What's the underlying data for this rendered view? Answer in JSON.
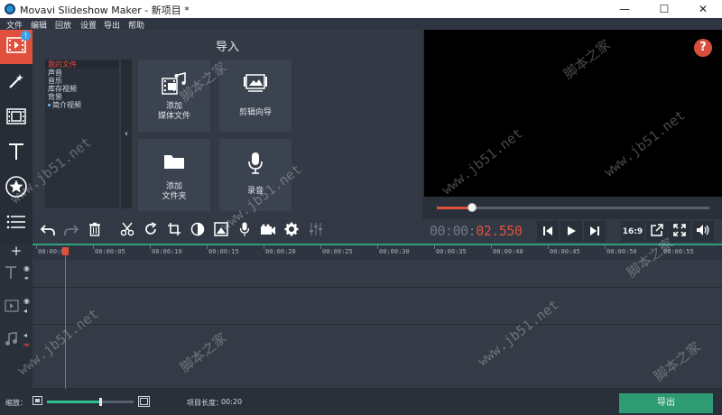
{
  "window": {
    "title": "Movavi Slideshow Maker - 新项目 *",
    "controls": {
      "minimize": "—",
      "maximize": "☐",
      "close": "✕"
    }
  },
  "menu": [
    "文件",
    "编辑",
    "回放",
    "设置",
    "导出",
    "帮助"
  ],
  "sidebar": {
    "badge": "!",
    "tools": [
      {
        "name": "import-tool",
        "icon": "film-import-icon",
        "active": true
      },
      {
        "name": "filters-tool",
        "icon": "magic-wand-icon"
      },
      {
        "name": "transitions-tool",
        "icon": "transition-icon"
      },
      {
        "name": "titles-tool",
        "icon": "text-t-icon"
      },
      {
        "name": "stickers-tool",
        "icon": "star-icon"
      },
      {
        "name": "more-tool",
        "icon": "list-icon"
      }
    ]
  },
  "import_panel": {
    "title": "导入",
    "tree": [
      {
        "label": "我的文件",
        "selected": true
      },
      {
        "label": "声音"
      },
      {
        "label": "音乐"
      },
      {
        "label": "库存视频"
      },
      {
        "label": "背景"
      },
      {
        "label": "简介视频",
        "bullet": true
      }
    ],
    "collapse_icon": "‹",
    "tiles": {
      "add_media": {
        "line1": "添加",
        "line2": "媒体文件",
        "icon": "media-file-icon"
      },
      "montage": {
        "line1": "剪辑向导",
        "icon": "montage-wizard-icon"
      },
      "add_folder": {
        "line1": "添加",
        "line2": "文件夹",
        "icon": "folder-icon"
      },
      "record": {
        "line1": "录音",
        "icon": "microphone-icon"
      }
    }
  },
  "preview": {
    "help_label": "?",
    "scrub_progress": 0.128
  },
  "playback": {
    "timecode_prefix": "00:00:",
    "timecode_value": "02.550",
    "aspect": "16:9"
  },
  "timeline": {
    "add_label": "+",
    "ticks": [
      "00:00:00",
      "00:00:05",
      "00:00:10",
      "00:00:15",
      "00:00:20",
      "00:00:25",
      "00:00:30",
      "00:00:35",
      "00:00:40",
      "00:00:45",
      "00:00:50",
      "00:00:55"
    ]
  },
  "statusbar": {
    "zoom_label": "缩放：",
    "zoom_level": 0.6,
    "project_length_label": "项目长度：",
    "project_length": "00:20",
    "export_label": "导出"
  },
  "watermarks": {
    "cn": "脚本之家",
    "en": "www.jb51.net"
  }
}
